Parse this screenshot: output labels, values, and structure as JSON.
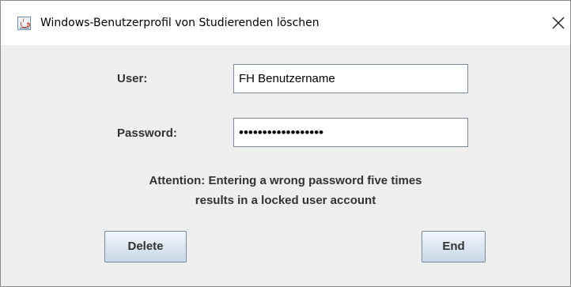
{
  "window": {
    "title": "Windows-Benutzerprofil von Studierenden löschen",
    "icon": "java-cup-icon",
    "close_icon": "close-icon"
  },
  "form": {
    "user_label": "User:",
    "user_value": "FH Benutzername",
    "password_label": "Password:",
    "password_value": "••••••••••••••••••"
  },
  "notice": {
    "line1": "Attention: Entering a wrong password five times",
    "line2": "results in a locked user account"
  },
  "buttons": {
    "delete_label": "Delete",
    "end_label": "End"
  },
  "colors": {
    "dialog_background": "#eeeeee",
    "titlebar_background": "#ffffff",
    "text": "#333333",
    "field_border": "#7a8a99"
  }
}
